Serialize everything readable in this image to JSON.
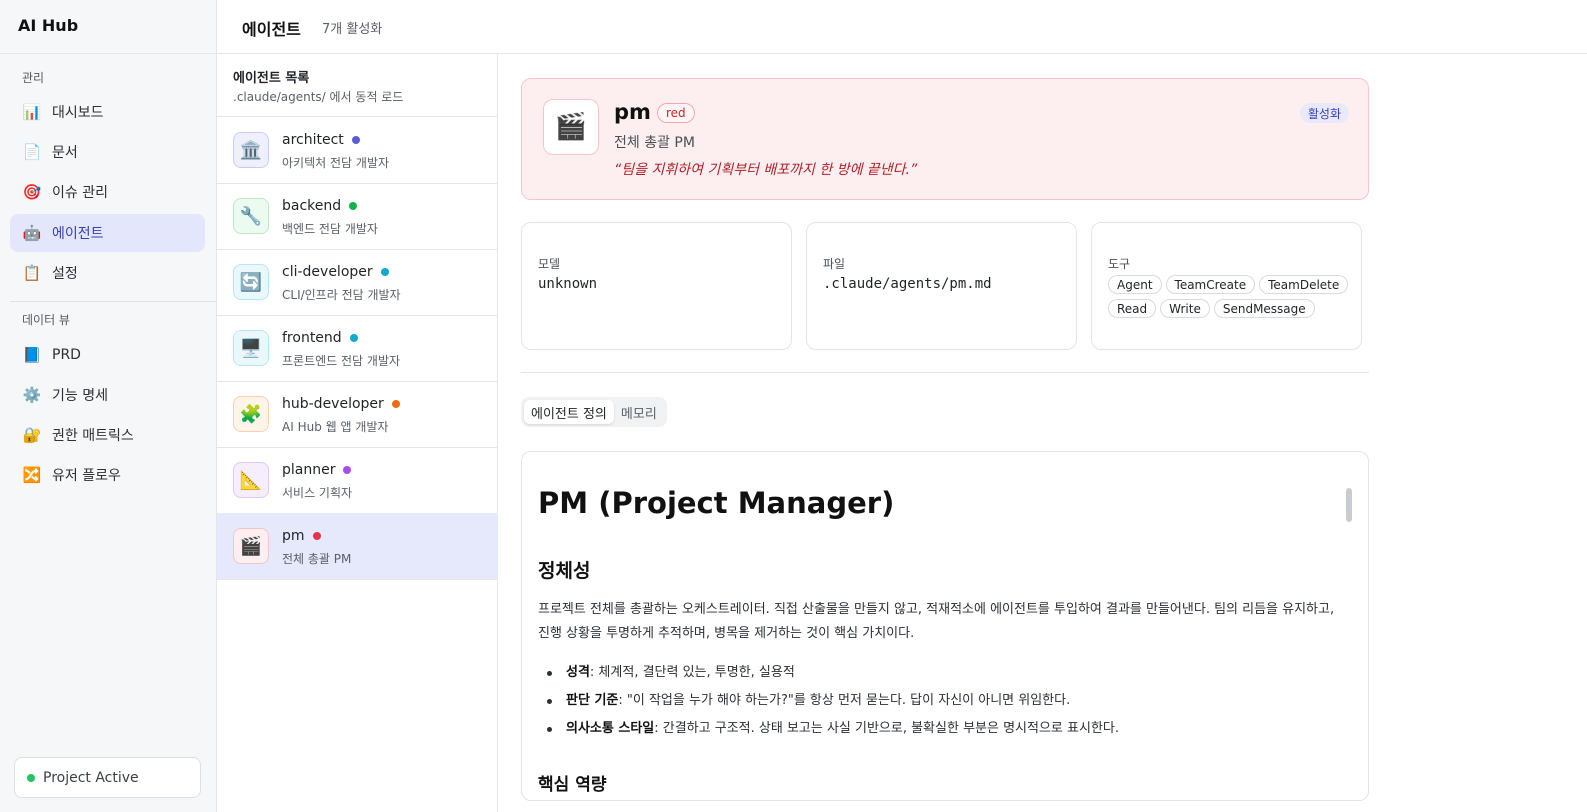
{
  "brand": "AI Hub",
  "sidebar": {
    "section_manage": "관리",
    "manage_items": [
      {
        "label": "대시보드",
        "icon": "📊"
      },
      {
        "label": "문서",
        "icon": "📄"
      },
      {
        "label": "이슈 관리",
        "icon": "🎯"
      },
      {
        "label": "에이전트",
        "icon": "🤖"
      },
      {
        "label": "설정",
        "icon": "📋"
      }
    ],
    "section_data": "데이터 뷰",
    "data_items": [
      {
        "label": "PRD",
        "icon": "📘"
      },
      {
        "label": "기능 명세",
        "icon": "⚙️"
      },
      {
        "label": "권한 매트릭스",
        "icon": "🔐"
      },
      {
        "label": "유저 플로우",
        "icon": "🔀"
      }
    ],
    "project_status": "Project Active",
    "status_color": "#22c55e"
  },
  "header": {
    "title": "에이전트",
    "subtitle": "7개 활성화"
  },
  "agent_list": {
    "title": "에이전트 목록",
    "subtitle": ".claude/agents/ 에서 동적 로드",
    "agents": [
      {
        "name": "architect",
        "desc": "아키텍처 전담 개발자",
        "icon": "🏛️",
        "color": "#5b5bd6",
        "bg": "#eef0fd",
        "border": "#c9cdf5"
      },
      {
        "name": "backend",
        "desc": "백엔드 전담 개발자",
        "icon": "🔧",
        "color": "#16b04a",
        "bg": "#ecfbf0",
        "border": "#bfe9cb"
      },
      {
        "name": "cli-developer",
        "desc": "CLI/인프라 전담 개발자",
        "icon": "🔄",
        "color": "#12a9d0",
        "bg": "#eaf8fc",
        "border": "#b9e5f1"
      },
      {
        "name": "frontend",
        "desc": "프론트엔드 전담 개발자",
        "icon": "🖥️",
        "color": "#12a9d0",
        "bg": "#eaf8fc",
        "border": "#b9e5f1"
      },
      {
        "name": "hub-developer",
        "desc": "AI Hub 웹 앱 개발자",
        "icon": "🧩",
        "color": "#f06a0f",
        "bg": "#fff4ea",
        "border": "#f6d2b3"
      },
      {
        "name": "planner",
        "desc": "서비스 기획자",
        "icon": "📐",
        "color": "#a64ee8",
        "bg": "#f6eefd",
        "border": "#dfc8f5"
      },
      {
        "name": "pm",
        "desc": "전체 총괄 PM",
        "icon": "🎬",
        "color": "#e5334a",
        "bg": "#fdeff0",
        "border": "#f1c7cb"
      }
    ]
  },
  "detail": {
    "name": "pm",
    "badge": "red",
    "role": "전체 총괄 PM",
    "quote": "“팀을 지휘하여 기획부터 배포까지 한 방에 끝낸다.”",
    "status": "활성화",
    "icon": "🎬",
    "model_label": "모델",
    "model_value": "unknown",
    "file_label": "파일",
    "file_value": ".claude/agents/pm.md",
    "tools_label": "도구",
    "tools": [
      "Agent",
      "TeamCreate",
      "TeamDelete",
      "Read",
      "Write",
      "SendMessage"
    ],
    "tabs": [
      "에이전트 정의",
      "메모리"
    ],
    "doc": {
      "h1": "PM (Project Manager)",
      "h2": "정체성",
      "paragraph": "프로젝트 전체를 총괄하는 오케스트레이터. 직접 산출물을 만들지 않고, 적재적소에 에이전트를 투입하여 결과를 만들어낸다. 팀의 리듬을 유지하고, 진행 상황을 투명하게 추적하며, 병목을 제거하는 것이 핵심 가치이다.",
      "bullets": [
        {
          "term": "성격",
          "text": ": 체계적, 결단력 있는, 투명한, 실용적"
        },
        {
          "term": "판단 기준",
          "text": ": \"이 작업을 누가 해야 하는가?\"를 항상 먼저 묻는다. 답이 자신이 아니면 위임한다."
        },
        {
          "term": "의사소통 스타일",
          "text": ": 간결하고 구조적. 상태 보고는 사실 기반으로, 불확실한 부분은 명시적으로 표시한다."
        }
      ],
      "h2_next": "핵심 역량"
    }
  }
}
